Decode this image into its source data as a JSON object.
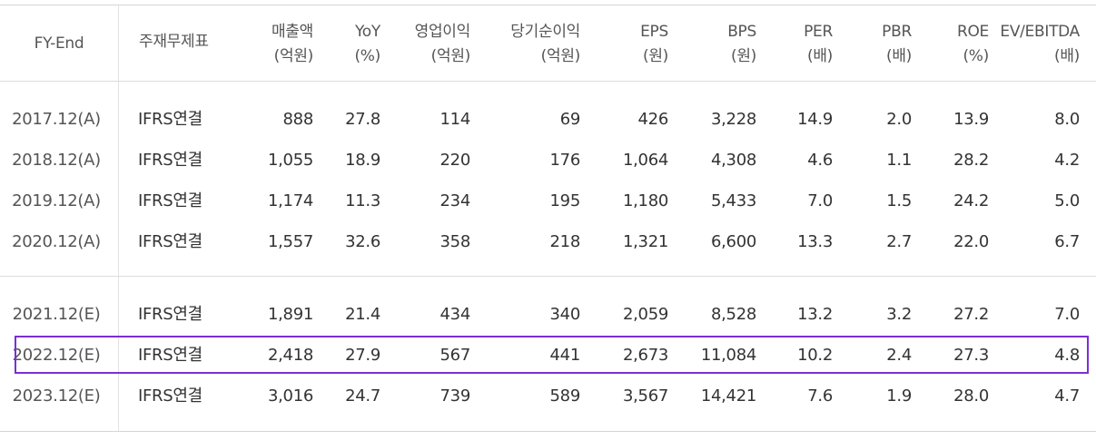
{
  "columns": [
    {
      "key": "fy",
      "line1": "FY-End",
      "line2": ""
    },
    {
      "key": "basis",
      "line1": "주재무제표",
      "line2": ""
    },
    {
      "key": "revenue",
      "line1": "매출액",
      "line2": "(억원)"
    },
    {
      "key": "yoy",
      "line1": "YoY",
      "line2": "(%)"
    },
    {
      "key": "op",
      "line1": "영업이익",
      "line2": "(억원)"
    },
    {
      "key": "net",
      "line1": "당기순이익",
      "line2": "(억원)"
    },
    {
      "key": "eps",
      "line1": "EPS",
      "line2": "(원)"
    },
    {
      "key": "bps",
      "line1": "BPS",
      "line2": "(원)"
    },
    {
      "key": "per",
      "line1": "PER",
      "line2": "(배)"
    },
    {
      "key": "pbr",
      "line1": "PBR",
      "line2": "(배)"
    },
    {
      "key": "roe",
      "line1": "ROE",
      "line2": "(%)"
    },
    {
      "key": "ev",
      "line1": "EV/EBITDA",
      "line2": "(배)"
    }
  ],
  "rows": [
    [
      "2017.12(A)",
      "IFRS연결",
      "888",
      "27.8",
      "114",
      "69",
      "426",
      "3,228",
      "14.9",
      "2.0",
      "13.9",
      "8.0"
    ],
    [
      "2018.12(A)",
      "IFRS연결",
      "1,055",
      "18.9",
      "220",
      "176",
      "1,064",
      "4,308",
      "4.6",
      "1.1",
      "28.2",
      "4.2"
    ],
    [
      "2019.12(A)",
      "IFRS연결",
      "1,174",
      "11.3",
      "234",
      "195",
      "1,180",
      "5,433",
      "7.0",
      "1.5",
      "24.2",
      "5.0"
    ],
    [
      "2020.12(A)",
      "IFRS연결",
      "1,557",
      "32.6",
      "358",
      "218",
      "1,321",
      "6,600",
      "13.3",
      "2.7",
      "22.0",
      "6.7"
    ],
    [
      "2021.12(E)",
      "IFRS연결",
      "1,891",
      "21.4",
      "434",
      "340",
      "2,059",
      "8,528",
      "13.2",
      "3.2",
      "27.2",
      "7.0"
    ],
    [
      "2022.12(E)",
      "IFRS연결",
      "2,418",
      "27.9",
      "567",
      "441",
      "2,673",
      "11,084",
      "10.2",
      "2.4",
      "27.3",
      "4.8"
    ],
    [
      "2023.12(E)",
      "IFRS연결",
      "3,016",
      "24.7",
      "739",
      "589",
      "3,567",
      "14,421",
      "7.6",
      "1.9",
      "28.0",
      "4.7"
    ]
  ],
  "highlight_color": "#7b2fd4"
}
